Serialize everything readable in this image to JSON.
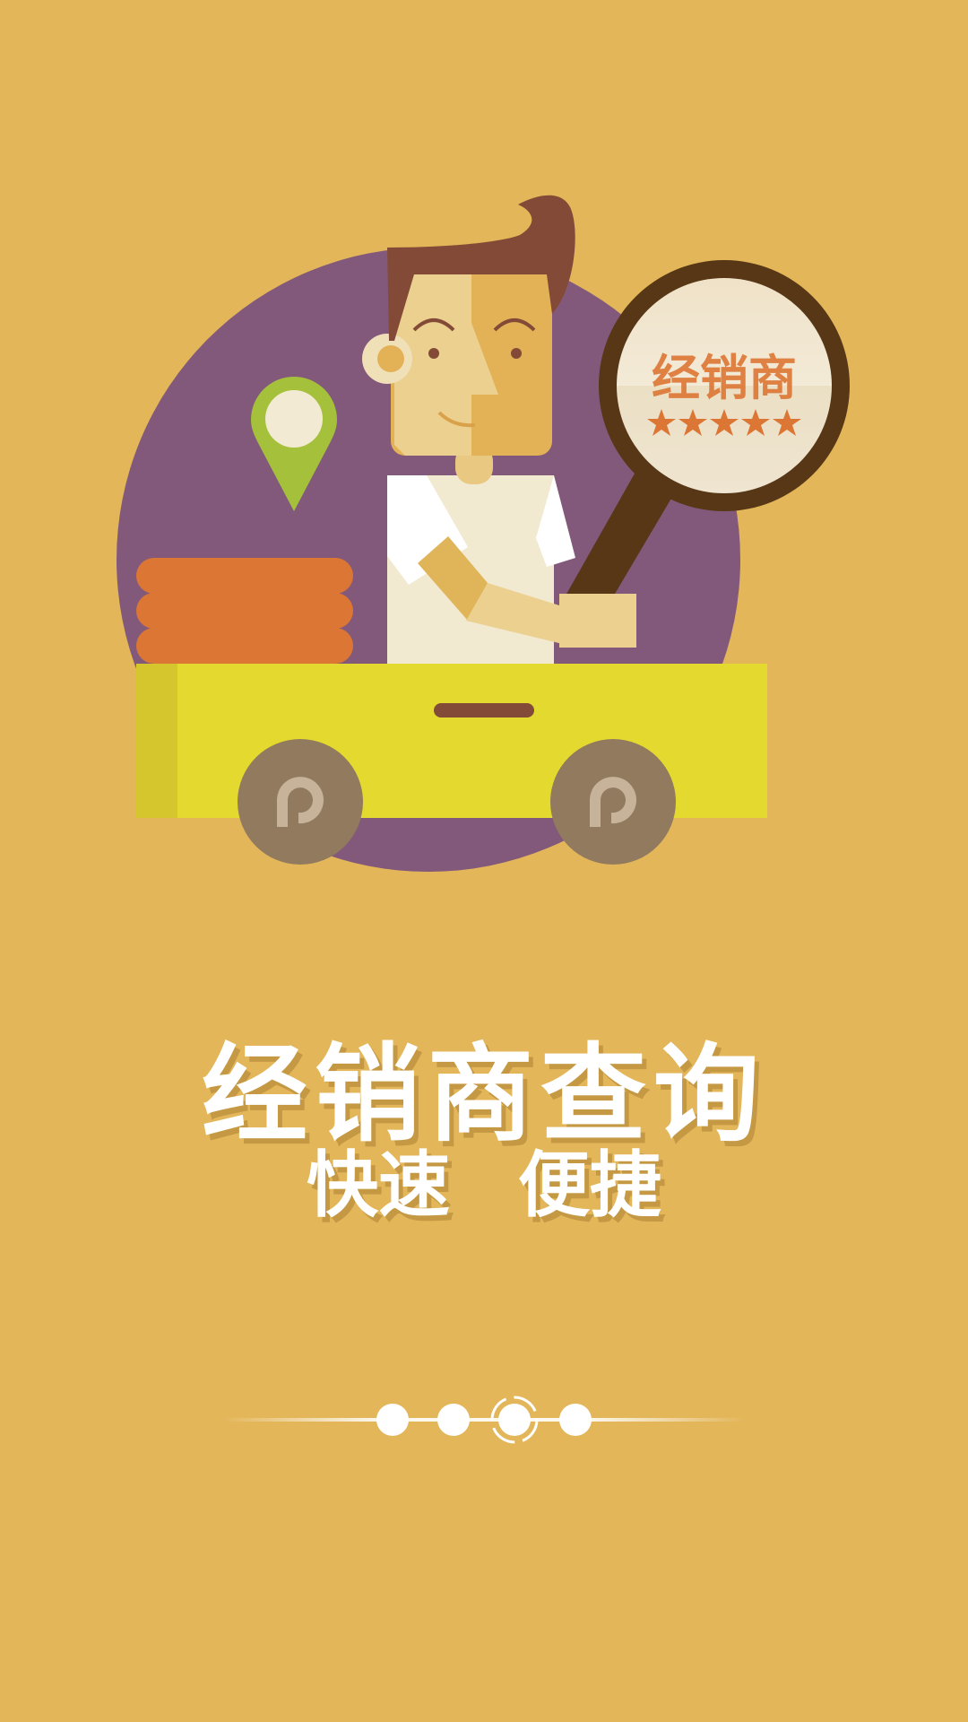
{
  "illustration": {
    "magnifier_label": "经销商",
    "rating_stars": 5,
    "colors": {
      "background": "#e3b65a",
      "circle": "#82597b",
      "cart": "#e4da2f",
      "boxes": "#dc7634",
      "pin": "#a5c13c",
      "hair": "#834b37",
      "magnifier_frame": "#573716",
      "wheel": "#927a5e"
    },
    "icons": [
      "location-pin-icon",
      "magnifier-icon",
      "star-icon",
      "wheel-logo-icon"
    ]
  },
  "headline": {
    "title": "经销商查询",
    "subtitle": "快速  便捷"
  },
  "pager": {
    "total": 4,
    "current": 3
  }
}
